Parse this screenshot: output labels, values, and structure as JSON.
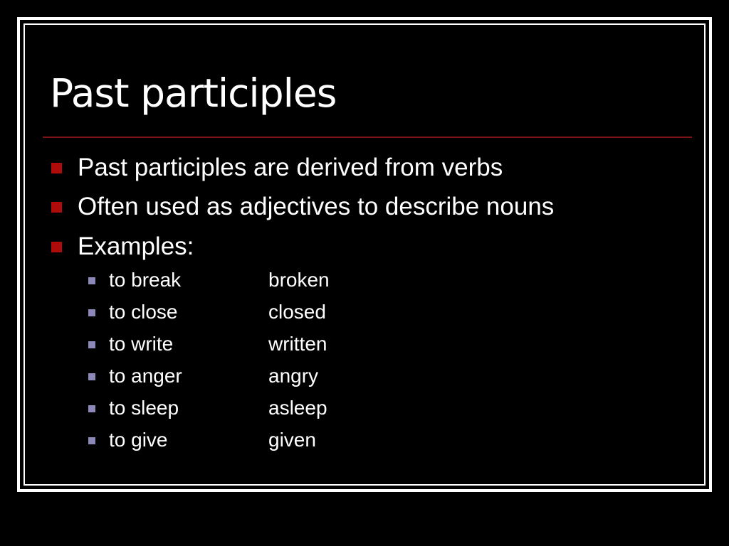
{
  "slide": {
    "title": "Past participles",
    "colors": {
      "background": "#000000",
      "text": "#ffffff",
      "divider": "#7a1414",
      "bullet_level1": "#b00b0b",
      "bullet_level2": "#8c88b8"
    },
    "bullets": [
      {
        "text": "Past participles are derived from verbs"
      },
      {
        "text": "Often used as adjectives to describe nouns"
      },
      {
        "text": "Examples:"
      }
    ],
    "examples": [
      {
        "verb": "to break",
        "participle": "broken"
      },
      {
        "verb": "to close",
        "participle": "closed"
      },
      {
        "verb": "to write",
        "participle": "written"
      },
      {
        "verb": "to anger",
        "participle": "angry"
      },
      {
        "verb": "to sleep",
        "participle": "asleep"
      },
      {
        "verb": "to give",
        "participle": "given"
      }
    ]
  }
}
